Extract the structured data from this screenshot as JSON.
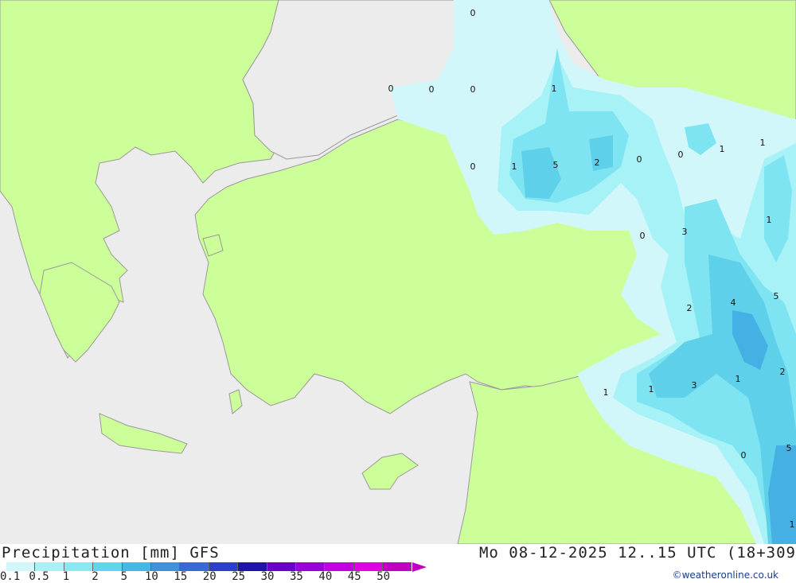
{
  "title_left": "Precipitation [mm] GFS",
  "title_right": "Mo 08-12-2025 12..15 UTC (18+309",
  "credit": "©weatheronline.co.uk",
  "legend": {
    "ticks": [
      "0.1",
      "0.5",
      "1",
      "2",
      "5",
      "10",
      "15",
      "20",
      "25",
      "30",
      "35",
      "40",
      "45",
      "50"
    ],
    "colors": [
      "#d2f7fa",
      "#a6f2f7",
      "#88e9f2",
      "#5fd6ea",
      "#44b8e6",
      "#3f93de",
      "#3a68d6",
      "#2d3fc8",
      "#1f14a8",
      "#6a00c8",
      "#9b00d8",
      "#c000e0",
      "#e000e0",
      "#c000c0"
    ]
  },
  "map_values": [
    "0",
    "0",
    "0",
    "0",
    "1",
    "0",
    "1",
    "5",
    "2",
    "0",
    "0",
    "1",
    "1",
    "3",
    "0",
    "1",
    "2",
    "4",
    "5",
    "3",
    "1",
    "1",
    "1",
    "2",
    "0",
    "5",
    "1"
  ],
  "colors": {
    "land": "#ccff99",
    "sea": "#ececec",
    "border": "#999999",
    "p01": "#d2f7fa",
    "p1": "#a6f2f7",
    "p2": "#7fe4f2",
    "p5": "#5fd0ea",
    "p10": "#44b0e4"
  }
}
